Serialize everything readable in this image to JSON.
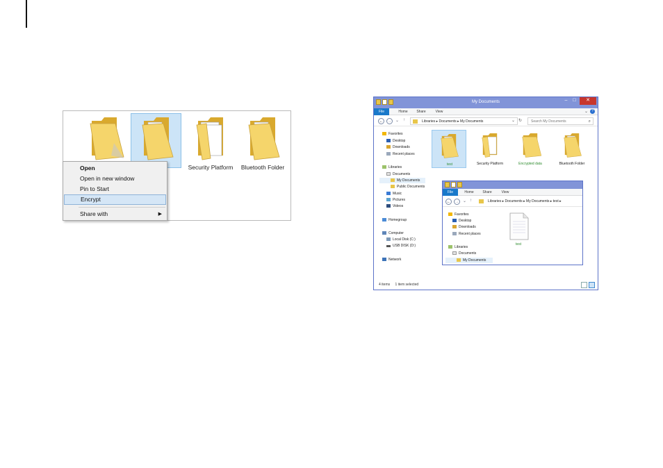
{
  "left_panel": {
    "folders": [
      {
        "name": "",
        "selected": false
      },
      {
        "name": "",
        "selected": true
      },
      {
        "name": "Security Platform",
        "selected": false
      },
      {
        "name": "Bluetooth Folder",
        "selected": false
      }
    ],
    "context_menu": {
      "items": [
        "Open",
        "Open in new window",
        "Pin to Start",
        "Encrypt",
        "Share with"
      ],
      "highlighted": "Encrypt"
    }
  },
  "explorer": {
    "title": "My Documents",
    "ribbon_tabs": [
      "File",
      "Home",
      "Share",
      "View"
    ],
    "help": "?",
    "address": {
      "path": "Libraries ▸ Documents ▸ My Documents",
      "search_placeholder": "Search My Documents"
    },
    "nav": {
      "favorites": "Favorites",
      "desktop": "Desktop",
      "downloads": "Downloads",
      "recent": "Recent places",
      "libraries": "Libraries",
      "documents": "Documents",
      "my_documents": "My Documents",
      "public_documents": "Public Documents",
      "music": "Music",
      "pictures": "Pictures",
      "videos": "Videos",
      "homegroup": "Homegroup",
      "computer": "Computer",
      "local_disk": "Local Disk (C:)",
      "usb_disk": "USB DISK (D:)",
      "network": "Network"
    },
    "items": [
      {
        "name": "test",
        "highlight": true
      },
      {
        "name": "Security Platform",
        "highlight": false
      },
      {
        "name": "Encrypted data",
        "highlight": true
      },
      {
        "name": "Bluetooth Folder",
        "highlight": false
      }
    ],
    "highlight_color": "#2e8b2e",
    "status": {
      "count": "4 items",
      "selected": "1 item selected"
    },
    "inner_window": {
      "ribbon_tabs": [
        "File",
        "Home",
        "Share",
        "View"
      ],
      "path": "Libraries ▸ Documents ▸ My Documents ▸ test ▸",
      "nav": {
        "favorites": "Favorites",
        "desktop": "Desktop",
        "downloads": "Downloads",
        "recent": "Recent places",
        "libraries": "Libraries",
        "documents": "Documents",
        "my_documents": "My Documents"
      },
      "file": {
        "name": "test"
      }
    }
  }
}
